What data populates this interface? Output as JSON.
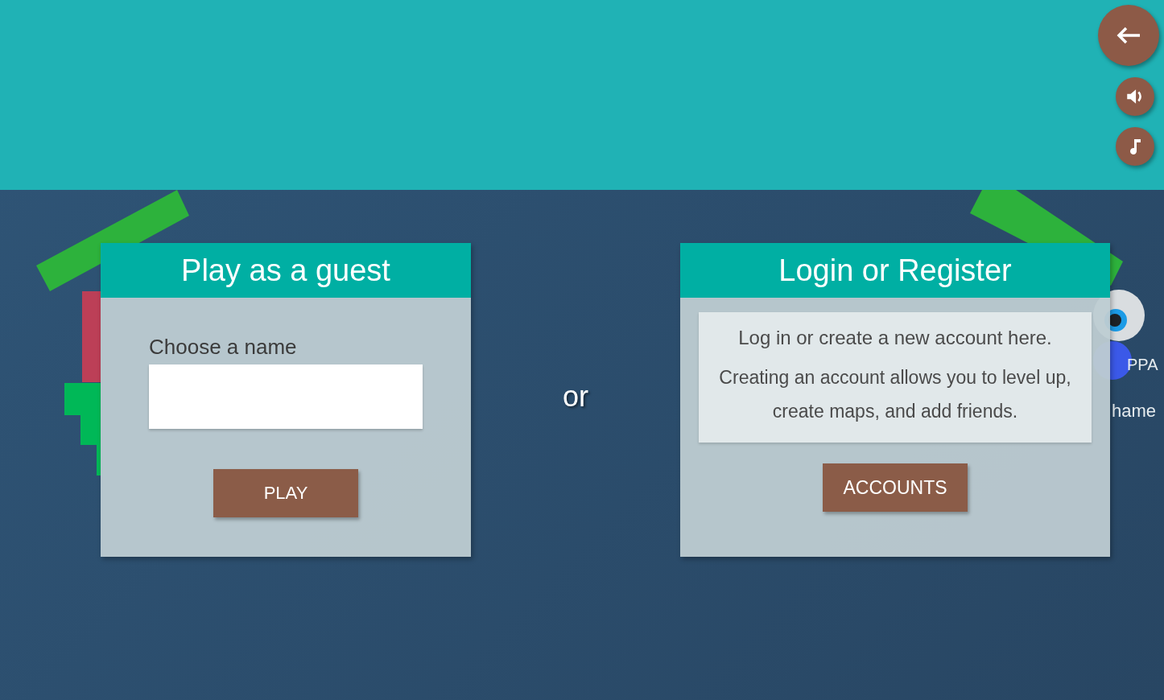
{
  "guest_card": {
    "title": "Play as a guest",
    "name_label": "Choose a name",
    "play_button": "PLAY"
  },
  "separator": "or",
  "account_card": {
    "title": "Login or Register",
    "intro": "Log in or create a new account here.",
    "description": "Creating an account allows you to level up, create maps, and add friends.",
    "accounts_button": "ACCOUNTS"
  },
  "background_texts": [
    "PPA",
    "hame"
  ]
}
